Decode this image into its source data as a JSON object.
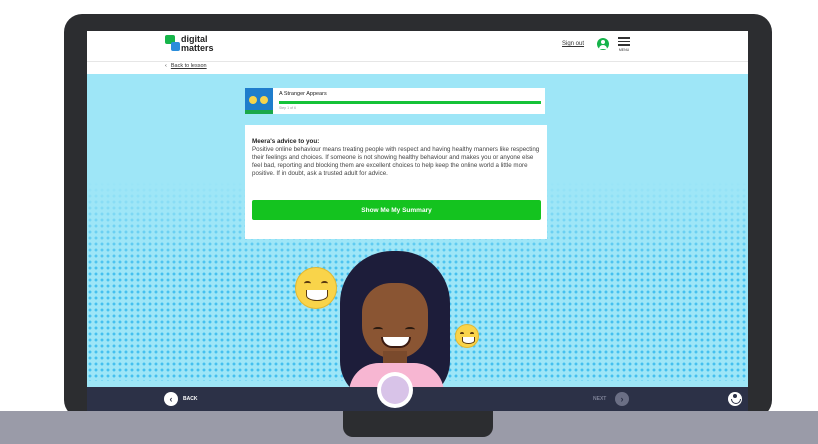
{
  "header": {
    "logo_line1": "digital",
    "logo_line2": "matters",
    "sign_out": "Sign out",
    "menu_label": "MENU"
  },
  "nav": {
    "back_to_lesson": "Back to lesson",
    "back_arrow": "‹"
  },
  "lesson": {
    "title": "A Stranger Appears",
    "step": "Step 1 of 6",
    "progress": 1.0
  },
  "advice": {
    "title": "Meera's advice to you:",
    "body": "Positive online behaviour means treating people with respect and having healthy manners like respecting their feelings and choices. If someone is not showing healthy behaviour and makes you or anyone else feel bad, reporting and blocking them are excellent choices to help keep the online world a little more positive. If in doubt, ask a trusted adult for advice.",
    "button": "Show Me My Summary"
  },
  "footer": {
    "back_label": "BACK",
    "next_label": "NEXT"
  },
  "colors": {
    "accent_green": "#14c31f",
    "sky": "#9ee6f7",
    "footer": "#2c3147"
  }
}
